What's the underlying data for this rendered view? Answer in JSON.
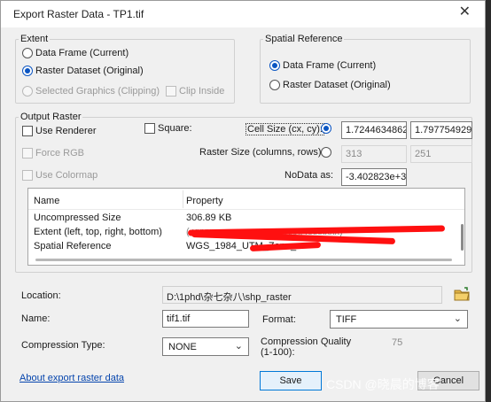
{
  "window": {
    "title": "Export Raster Data - TP1.tif",
    "close_glyph": "✕"
  },
  "extent": {
    "label": "Extent",
    "options": [
      {
        "label": "Data Frame (Current)",
        "checked": false,
        "enabled": true
      },
      {
        "label": "Raster Dataset (Original)",
        "checked": true,
        "enabled": true
      },
      {
        "label": "Selected Graphics (Clipping)",
        "checked": false,
        "enabled": false
      }
    ],
    "clip_inside": {
      "label": "Clip Inside",
      "checked": false,
      "enabled": false
    }
  },
  "spatial_reference": {
    "label": "Spatial Reference",
    "options": [
      {
        "label": "Data Frame (Current)",
        "checked": true
      },
      {
        "label": "Raster Dataset (Original)",
        "checked": false
      }
    ]
  },
  "output_raster": {
    "label": "Output Raster",
    "use_renderer": "Use Renderer",
    "square": "Square:",
    "force_rgb": "Force RGB",
    "use_colormap": "Use Colormap",
    "cell_size_label": "Cell Size (cx, cy):",
    "cell_size_x": "1.7244634862",
    "cell_size_y": "1.7977549290",
    "raster_size_label": "Raster Size (columns, rows):",
    "raster_cols": "313",
    "raster_rows": "251",
    "nodata_label": "NoData as:",
    "nodata_value": "-3.402823e+3",
    "table": {
      "headers": [
        "Name",
        "Property"
      ],
      "rows": [
        {
          "name": "Uncompressed Size",
          "value": "306.89 KB"
        },
        {
          "name": "Extent (left, top, right, bottom)",
          "value": "(   xxxxxxx xxxxxxx xxxxxxx, xxxxxxx)"
        },
        {
          "name": "Spatial Reference",
          "value": "WGS_1984_UTM_Zone_"
        }
      ]
    }
  },
  "location": {
    "label": "Location:",
    "value": "D:\\1phd\\杂七杂八\\shp_raster"
  },
  "name": {
    "label": "Name:",
    "value": "tif1.tif"
  },
  "format": {
    "label": "Format:",
    "value": "TIFF"
  },
  "compression_type": {
    "label": "Compression Type:",
    "value": "NONE"
  },
  "compression_quality": {
    "label": "Compression Quality (1-100):",
    "value": "75"
  },
  "footer": {
    "about_link": "About export raster data",
    "save": "Save",
    "cancel": "Cancel"
  },
  "watermark": "CSDN @晓晨的博客",
  "colors": {
    "accent": "#0b55c2",
    "link": "#0645ad",
    "redaction": "#ff1010"
  }
}
